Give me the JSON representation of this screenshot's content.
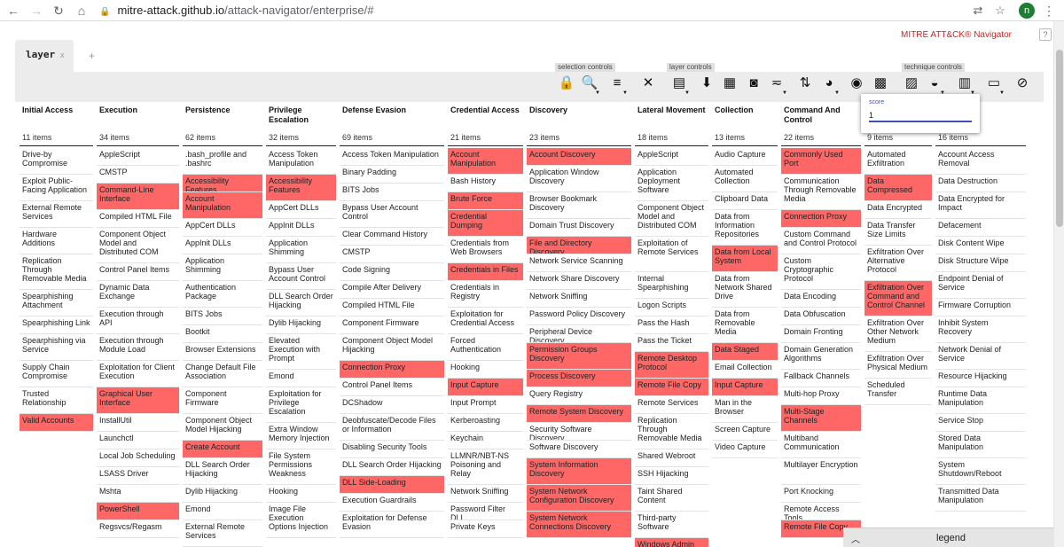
{
  "browser": {
    "url_host": "mitre-attack.github.io",
    "url_path": "/attack-navigator/enterprise/#",
    "avatar_letter": "n"
  },
  "app": {
    "brand": "MITRE ATT&CK® Navigator",
    "help": "?",
    "layer_tab": "layer",
    "tab_close": "x",
    "new_tab": "+",
    "groups": {
      "selection": "selection controls",
      "layer": "layer controls",
      "technique": "technique controls"
    }
  },
  "score_popup": {
    "label": "score",
    "value": "1"
  },
  "legend": {
    "label": "legend"
  },
  "colors": {
    "highlight": "#ff6666",
    "brand": "#c62828",
    "accent": "#3f51b5"
  },
  "tactics": [
    {
      "name": "Initial Access",
      "count": "11 items",
      "techniques": [
        {
          "t": "Drive-by Compromise",
          "h": 2
        },
        {
          "t": "Exploit Public-Facing Application",
          "h": 2
        },
        {
          "t": "External Remote Services",
          "h": 2
        },
        {
          "t": "Hardware Additions",
          "h": 2
        },
        {
          "t": "Replication Through Removable Media",
          "h": 3
        },
        {
          "t": "Spearphishing Attachment",
          "h": 2
        },
        {
          "t": "Spearphishing Link",
          "h": 1
        },
        {
          "t": "Spearphishing via Service",
          "h": 2
        },
        {
          "t": "Supply Chain Compromise",
          "h": 2
        },
        {
          "t": "Trusted Relationship",
          "h": 2
        },
        {
          "t": "Valid Accounts",
          "h": 1,
          "on": true
        }
      ]
    },
    {
      "name": "Execution",
      "count": "34 items",
      "techniques": [
        {
          "t": "AppleScript",
          "h": 1
        },
        {
          "t": "CMSTP",
          "h": 1
        },
        {
          "t": "Command-Line Interface",
          "h": 2,
          "on": true
        },
        {
          "t": "Compiled HTML File",
          "h": 1
        },
        {
          "t": "Component Object Model and Distributed COM",
          "h": 3
        },
        {
          "t": "Control Panel Items",
          "h": 1
        },
        {
          "t": "Dynamic Data Exchange",
          "h": 2
        },
        {
          "t": "Execution through API",
          "h": 2
        },
        {
          "t": "Execution through Module Load",
          "h": 2
        },
        {
          "t": "Exploitation for Client Execution",
          "h": 2
        },
        {
          "t": "Graphical User Interface",
          "h": 2,
          "on": true
        },
        {
          "t": "InstallUtil",
          "h": 1
        },
        {
          "t": "Launchctl",
          "h": 1
        },
        {
          "t": "Local Job Scheduling",
          "h": 1
        },
        {
          "t": "LSASS Driver",
          "h": 1
        },
        {
          "t": "Mshta",
          "h": 1
        },
        {
          "t": "PowerShell",
          "h": 1,
          "on": true
        },
        {
          "t": "Regsvcs/Regasm",
          "h": 1
        }
      ]
    },
    {
      "name": "Persistence",
      "count": "62 items",
      "techniques": [
        {
          "t": ".bash_profile and .bashrc",
          "h": 2
        },
        {
          "t": "Accessibility Features",
          "h": 1,
          "on": true
        },
        {
          "t": "Account Manipulation",
          "h": 2,
          "on": true
        },
        {
          "t": "AppCert DLLs",
          "h": 1
        },
        {
          "t": "AppInit DLLs",
          "h": 1
        },
        {
          "t": "Application Shimming",
          "h": 2
        },
        {
          "t": "Authentication Package",
          "h": 2
        },
        {
          "t": "BITS Jobs",
          "h": 1
        },
        {
          "t": "Bootkit",
          "h": 1
        },
        {
          "t": "Browser Extensions",
          "h": 1
        },
        {
          "t": "Change Default File Association",
          "h": 2
        },
        {
          "t": "Component Firmware",
          "h": 2
        },
        {
          "t": "Component Object Model Hijacking",
          "h": 2
        },
        {
          "t": "Create Account",
          "h": 1,
          "on": true
        },
        {
          "t": "DLL Search Order Hijacking",
          "h": 2
        },
        {
          "t": "Dylib Hijacking",
          "h": 1
        },
        {
          "t": "Emond",
          "h": 1
        },
        {
          "t": "External Remote Services",
          "h": 2
        }
      ]
    },
    {
      "name": "Privilege Escalation",
      "count": "32 items",
      "techniques": [
        {
          "t": "Access Token Manipulation",
          "h": 2
        },
        {
          "t": "Accessibility Features",
          "h": 2,
          "on": true
        },
        {
          "t": "AppCert DLLs",
          "h": 1
        },
        {
          "t": "AppInit DLLs",
          "h": 1
        },
        {
          "t": "Application Shimming",
          "h": 2
        },
        {
          "t": "Bypass User Account Control",
          "h": 2
        },
        {
          "t": "DLL Search Order Hijacking",
          "h": 2
        },
        {
          "t": "Dylib Hijacking",
          "h": 1
        },
        {
          "t": "Elevated Execution with Prompt",
          "h": 3
        },
        {
          "t": "Emond",
          "h": 1
        },
        {
          "t": "Exploitation for Privilege Escalation",
          "h": 3
        },
        {
          "t": "Extra Window Memory Injection",
          "h": 2
        },
        {
          "t": "File System Permissions Weakness",
          "h": 3
        },
        {
          "t": "Hooking",
          "h": 1
        },
        {
          "t": "Image File Execution Options Injection",
          "h": 3
        }
      ]
    },
    {
      "name": "Defense Evasion",
      "count": "69 items",
      "techniques": [
        {
          "t": "Access Token Manipulation",
          "h": 1
        },
        {
          "t": "Binary Padding",
          "h": 1
        },
        {
          "t": "BITS Jobs",
          "h": 1
        },
        {
          "t": "Bypass User Account Control",
          "h": 2
        },
        {
          "t": "Clear Command History",
          "h": 1
        },
        {
          "t": "CMSTP",
          "h": 1
        },
        {
          "t": "Code Signing",
          "h": 1
        },
        {
          "t": "Compile After Delivery",
          "h": 1
        },
        {
          "t": "Compiled HTML File",
          "h": 1
        },
        {
          "t": "Component Firmware",
          "h": 1
        },
        {
          "t": "Component Object Model Hijacking",
          "h": 2
        },
        {
          "t": "Connection Proxy",
          "h": 1,
          "on": true
        },
        {
          "t": "Control Panel Items",
          "h": 1
        },
        {
          "t": "DCShadow",
          "h": 1
        },
        {
          "t": "Deobfuscate/Decode Files or Information",
          "h": 2
        },
        {
          "t": "Disabling Security Tools",
          "h": 1
        },
        {
          "t": "DLL Search Order Hijacking",
          "h": 1
        },
        {
          "t": "DLL Side-Loading",
          "h": 1,
          "on": true
        },
        {
          "t": "Execution Guardrails",
          "h": 1
        },
        {
          "t": "Exploitation for Defense Evasion",
          "h": 2
        }
      ]
    },
    {
      "name": "Credential Access",
      "count": "21 items",
      "techniques": [
        {
          "t": "Account Manipulation",
          "h": 2,
          "on": true
        },
        {
          "t": "Bash History",
          "h": 1
        },
        {
          "t": "Brute Force",
          "h": 1,
          "on": true
        },
        {
          "t": "Credential Dumping",
          "h": 2,
          "on": true
        },
        {
          "t": "Credentials from Web Browsers",
          "h": 2
        },
        {
          "t": "Credentials in Files",
          "h": 1,
          "on": true
        },
        {
          "t": "Credentials in Registry",
          "h": 2
        },
        {
          "t": "Exploitation for Credential Access",
          "h": 2
        },
        {
          "t": "Forced Authentication",
          "h": 2
        },
        {
          "t": "Hooking",
          "h": 1
        },
        {
          "t": "Input Capture",
          "h": 1,
          "on": true
        },
        {
          "t": "Input Prompt",
          "h": 1
        },
        {
          "t": "Kerberoasting",
          "h": 1
        },
        {
          "t": "Keychain",
          "h": 1
        },
        {
          "t": "LLMNR/NBT-NS Poisoning and Relay",
          "h": 3
        },
        {
          "t": "Network Sniffing",
          "h": 1
        },
        {
          "t": "Password Filter DLL",
          "h": 1
        },
        {
          "t": "Private Keys",
          "h": 1
        }
      ]
    },
    {
      "name": "Discovery",
      "count": "23 items",
      "techniques": [
        {
          "t": "Account Discovery",
          "h": 1,
          "on": true
        },
        {
          "t": "Application Window Discovery",
          "h": 2
        },
        {
          "t": "Browser Bookmark Discovery",
          "h": 2
        },
        {
          "t": "Domain Trust Discovery",
          "h": 1
        },
        {
          "t": "File and Directory Discovery",
          "h": 1,
          "on": true
        },
        {
          "t": "Network Service Scanning",
          "h": 1
        },
        {
          "t": "Network Share Discovery",
          "h": 1
        },
        {
          "t": "Network Sniffing",
          "h": 1
        },
        {
          "t": "Password Policy Discovery",
          "h": 1
        },
        {
          "t": "Peripheral Device Discovery",
          "h": 1
        },
        {
          "t": "Permission Groups Discovery",
          "h": 2,
          "on": true
        },
        {
          "t": "Process Discovery",
          "h": 1,
          "on": true
        },
        {
          "t": "Query Registry",
          "h": 1
        },
        {
          "t": "Remote System Discovery",
          "h": 1,
          "on": true
        },
        {
          "t": "Security Software Discovery",
          "h": 1
        },
        {
          "t": "Software Discovery",
          "h": 1
        },
        {
          "t": "System Information Discovery",
          "h": 2,
          "on": true
        },
        {
          "t": "System Network Configuration Discovery",
          "h": 2,
          "on": true
        },
        {
          "t": "System Network Connections Discovery",
          "h": 2,
          "on": true
        }
      ]
    },
    {
      "name": "Lateral Movement",
      "count": "18 items",
      "techniques": [
        {
          "t": "AppleScript",
          "h": 1
        },
        {
          "t": "Application Deployment Software",
          "h": 3
        },
        {
          "t": "Component Object Model and Distributed COM",
          "h": 3
        },
        {
          "t": "Exploitation of Remote Services",
          "h": 3
        },
        {
          "t": "Internal Spearphishing",
          "h": 2
        },
        {
          "t": "Logon Scripts",
          "h": 1
        },
        {
          "t": "Pass the Hash",
          "h": 1
        },
        {
          "t": "Pass the Ticket",
          "h": 1
        },
        {
          "t": "Remote Desktop Protocol",
          "h": 2,
          "on": true
        },
        {
          "t": "Remote File Copy",
          "h": 1,
          "on": true
        },
        {
          "t": "Remote Services",
          "h": 1
        },
        {
          "t": "Replication Through Removable Media",
          "h": 3
        },
        {
          "t": "Shared Webroot",
          "h": 1
        },
        {
          "t": "SSH Hijacking",
          "h": 1
        },
        {
          "t": "Taint Shared Content",
          "h": 2
        },
        {
          "t": "Third-party Software",
          "h": 2
        },
        {
          "t": "Windows Admin",
          "h": 1,
          "on": true
        }
      ]
    },
    {
      "name": "Collection",
      "count": "13 items",
      "techniques": [
        {
          "t": "Audio Capture",
          "h": 1
        },
        {
          "t": "Automated Collection",
          "h": 2
        },
        {
          "t": "Clipboard Data",
          "h": 1
        },
        {
          "t": "Data from Information Repositories",
          "h": 3
        },
        {
          "t": "Data from Local System",
          "h": 2,
          "on": true
        },
        {
          "t": "Data from Network Shared Drive",
          "h": 3
        },
        {
          "t": "Data from Removable Media",
          "h": 3
        },
        {
          "t": "Data Staged",
          "h": 1,
          "on": true
        },
        {
          "t": "Email Collection",
          "h": 1
        },
        {
          "t": "Input Capture",
          "h": 1,
          "on": true
        },
        {
          "t": "Man in the Browser",
          "h": 2
        },
        {
          "t": "Screen Capture",
          "h": 1
        },
        {
          "t": "Video Capture",
          "h": 1
        }
      ]
    },
    {
      "name": "Command And Control",
      "count": "22 items",
      "techniques": [
        {
          "t": "Commonly Used Port",
          "h": 2,
          "on": true
        },
        {
          "t": "Communication Through Removable Media",
          "h": 3
        },
        {
          "t": "Connection Proxy",
          "h": 1,
          "on": true
        },
        {
          "t": "Custom Command and Control Protocol",
          "h": 2
        },
        {
          "t": "Custom Cryptographic Protocol",
          "h": 3
        },
        {
          "t": "Data Encoding",
          "h": 1
        },
        {
          "t": "Data Obfuscation",
          "h": 1
        },
        {
          "t": "Domain Fronting",
          "h": 1
        },
        {
          "t": "Domain Generation Algorithms",
          "h": 2
        },
        {
          "t": "Fallback Channels",
          "h": 1
        },
        {
          "t": "Multi-hop Proxy",
          "h": 1
        },
        {
          "t": "Multi-Stage Channels",
          "h": 2,
          "on": true
        },
        {
          "t": "Multiband Communication",
          "h": 2
        },
        {
          "t": "Multilayer Encryption",
          "h": 2
        },
        {
          "t": "Port Knocking",
          "h": 1
        },
        {
          "t": "Remote Access Tools",
          "h": 1
        },
        {
          "t": "Remote File Copy",
          "h": 1,
          "on": true
        }
      ]
    },
    {
      "name": "",
      "count": "9 items",
      "techniques": [
        {
          "t": "Automated Exfiltration",
          "h": 2
        },
        {
          "t": "Data Compressed",
          "h": 2,
          "on": true
        },
        {
          "t": "Data Encrypted",
          "h": 1
        },
        {
          "t": "Data Transfer Size Limits",
          "h": 2
        },
        {
          "t": "Exfiltration Over Alternative Protocol",
          "h": 3
        },
        {
          "t": "Exfiltration Over Command and Control Channel",
          "h": 3,
          "on": true
        },
        {
          "t": "Exfiltration Over Other Network Medium",
          "h": 3
        },
        {
          "t": "Exfiltration Over Physical Medium",
          "h": 2
        },
        {
          "t": "Scheduled Transfer",
          "h": 2
        }
      ]
    },
    {
      "name": "",
      "count": "16 items",
      "techniques": [
        {
          "t": "Account Access Removal",
          "h": 2
        },
        {
          "t": "Data Destruction",
          "h": 1
        },
        {
          "t": "Data Encrypted for Impact",
          "h": 2
        },
        {
          "t": "Defacement",
          "h": 1
        },
        {
          "t": "Disk Content Wipe",
          "h": 1
        },
        {
          "t": "Disk Structure Wipe",
          "h": 1
        },
        {
          "t": "Endpoint Denial of Service",
          "h": 2
        },
        {
          "t": "Firmware Corruption",
          "h": 1
        },
        {
          "t": "Inhibit System Recovery",
          "h": 2
        },
        {
          "t": "Network Denial of Service",
          "h": 2
        },
        {
          "t": "Resource Hijacking",
          "h": 1
        },
        {
          "t": "Runtime Data Manipulation",
          "h": 2
        },
        {
          "t": "Service Stop",
          "h": 1
        },
        {
          "t": "Stored Data Manipulation",
          "h": 2
        },
        {
          "t": "System Shutdown/Reboot",
          "h": 2
        },
        {
          "t": "Transmitted Data Manipulation",
          "h": 2
        }
      ]
    }
  ]
}
